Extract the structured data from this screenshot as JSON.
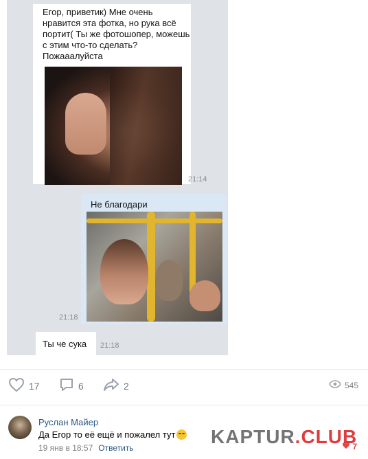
{
  "screenshot": {
    "msg_in_text": "Егор, приветик) Мне очень нравится эта фотка, но рука всё портит( Ты же фотошопер, можешь с этим что-то сделать? Пожааалуйста",
    "msg_in_time": "21:14",
    "msg_out_text": "Не благодари",
    "msg_out_time": "21:18",
    "msg_in2_text": "Ты че сука",
    "msg_in2_time": "21:18"
  },
  "actions": {
    "likes": "17",
    "comments": "6",
    "shares": "2",
    "views": "545"
  },
  "comment": {
    "author": "Руслан Майер",
    "text": "Да Егор то её ещё и пожалел тут",
    "date": "19 янв в 18:57",
    "reply_label": "Ответить",
    "likes": "7"
  },
  "watermark": {
    "part1": "KAPTUR",
    "part2": ".CLUB"
  },
  "colors": {
    "link": "#2a5885",
    "icon_gray": "#99a2ad",
    "like_red": "#e64646",
    "outgoing_bubble": "#dae8f6"
  },
  "icons": [
    "heart-icon",
    "comment-icon",
    "share-icon",
    "eye-icon",
    "emoji-icon"
  ]
}
